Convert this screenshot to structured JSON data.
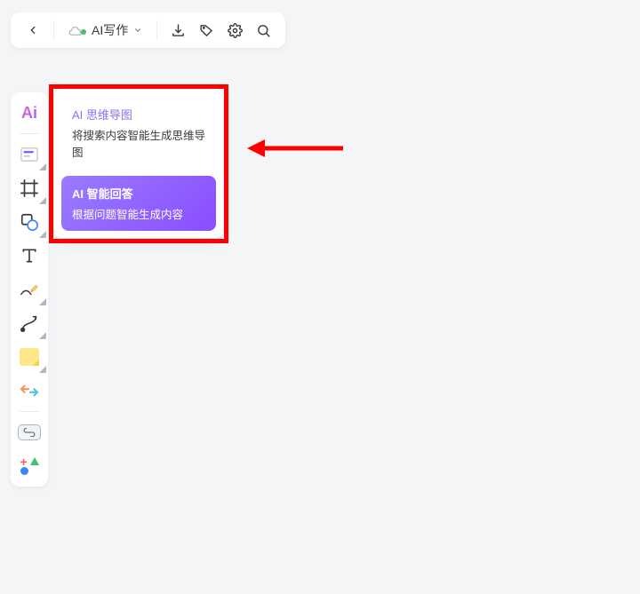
{
  "toolbar": {
    "ai_writing_label": "AI写作"
  },
  "side_tools": {
    "ai_label": "Ai"
  },
  "popup": {
    "mindmap": {
      "title": "AI 思维导图",
      "desc": "将搜索内容智能生成思维导图"
    },
    "answer": {
      "title": "AI 智能回答",
      "desc": "根据问题智能生成内容"
    }
  },
  "colors": {
    "highlight_red": "#ff0000",
    "accent_purple": "#8a4dff"
  }
}
